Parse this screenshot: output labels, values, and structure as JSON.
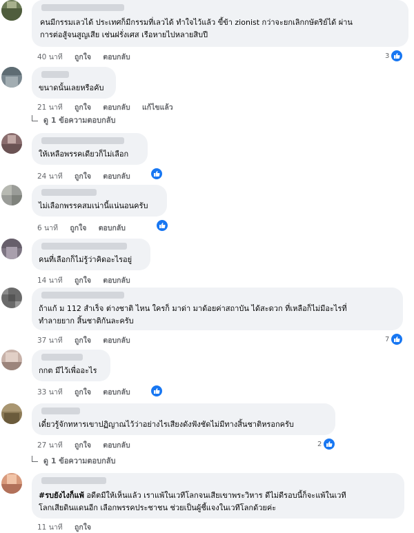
{
  "comments": [
    {
      "text_lines": [
        "คนมีกรรมเลวได้ ประเทศก็มีกรรมที่เลวได้ ทำใจไว้แล้ว ขี้ข้า zionist กว่าจะยกเลิกกษัตริย์ได้ ผ่าน",
        "การต่อสู้จนสูญเสีย เช่นฝรั่งเศส เรือหายไปหลายสิบปี"
      ],
      "time": "40 นาที",
      "like": "ถูกใจ",
      "reply": "ตอบกลับ",
      "edited": "",
      "reactions": "3",
      "replies_link": ""
    },
    {
      "text_lines": [
        "ขนาดนั้นเลยหรือคับ"
      ],
      "time": "21 นาที",
      "like": "ถูกใจ",
      "reply": "ตอบกลับ",
      "edited": "แก้ไขแล้ว",
      "reactions": "",
      "replies_link": "ดู 1 ข้อความตอบกลับ"
    },
    {
      "text_lines": [
        "ให้เหลือพรรคเดียวก็ไม่เลือก"
      ],
      "time": "24 นาที",
      "like": "ถูกใจ",
      "reply": "ตอบกลับ",
      "edited": "",
      "reactions": "",
      "replies_link": ""
    },
    {
      "text_lines": [
        "ไม่เลือกพรรคสมเน่านี้แน่นอนครับ"
      ],
      "time": "6 นาที",
      "like": "ถูกใจ",
      "reply": "ตอบกลับ",
      "edited": "",
      "reactions": "",
      "replies_link": ""
    },
    {
      "text_lines": [
        "คนที่เลือกก็ไม่รู้ว่าคิดอะไรอยู่"
      ],
      "time": "14 นาที",
      "like": "ถูกใจ",
      "reply": "ตอบกลับ",
      "edited": "",
      "reactions": "",
      "replies_link": ""
    },
    {
      "text_lines": [
        "ถ้าแก้ ม 112 สำเร็จ ต่างชาติ ไหน ใครก็ มาด่า มาด้อยค่าสถาบัน ได้สะดวก ที่เหลือก็ไม่มีอะไรที่",
        "ทำลายยาก สิ้นชาติกันละครับ"
      ],
      "time": "37 นาที",
      "like": "ถูกใจ",
      "reply": "ตอบกลับ",
      "edited": "",
      "reactions": "7",
      "replies_link": ""
    },
    {
      "text_lines": [
        "กกต มีไว้เพื่ออะไร"
      ],
      "time": "33 นาที",
      "like": "ถูกใจ",
      "reply": "ตอบกลับ",
      "edited": "",
      "reactions": "",
      "replies_link": ""
    },
    {
      "text_lines": [
        "เดี๋ยวรู้จักทหารเขาปฏิญาณไว้ว่าอย่างไรเสียงดังฟังชัดไม่มีทางสิ้นชาติหรอกครับ"
      ],
      "time": "27 นาที",
      "like": "ถูกใจ",
      "reply": "ตอบกลับ",
      "edited": "",
      "reactions": "2",
      "replies_link": "ดู 1 ข้อความตอบกลับ"
    },
    {
      "hashtag": "#รบยังไงก็แพ้",
      "text_lines": [
        " อดีตมีให้เห็นแล้ว เราแพ้ในเวทีโลกจนเสียเขาพระวิหาร ดีไม่ดีรอบนี้ก็จะแพ้ในเวที",
        "โลกเสียดินแดนอีก เลือกพรรคประชาชน ช่วยเป็นผู้ชี้แจงในเวทีโลกด้วยค่ะ"
      ],
      "time": "11 นาที",
      "like": "ถูกใจ",
      "reply": "",
      "edited": "",
      "reactions": "",
      "replies_link": ""
    }
  ],
  "colors": {
    "bubble": "#f0f2f5",
    "meta": "#65676b",
    "like_blue": "#1877f2"
  },
  "icons": {
    "reaction": "thumbs-up-icon",
    "replies": "reply-arrow-icon"
  }
}
